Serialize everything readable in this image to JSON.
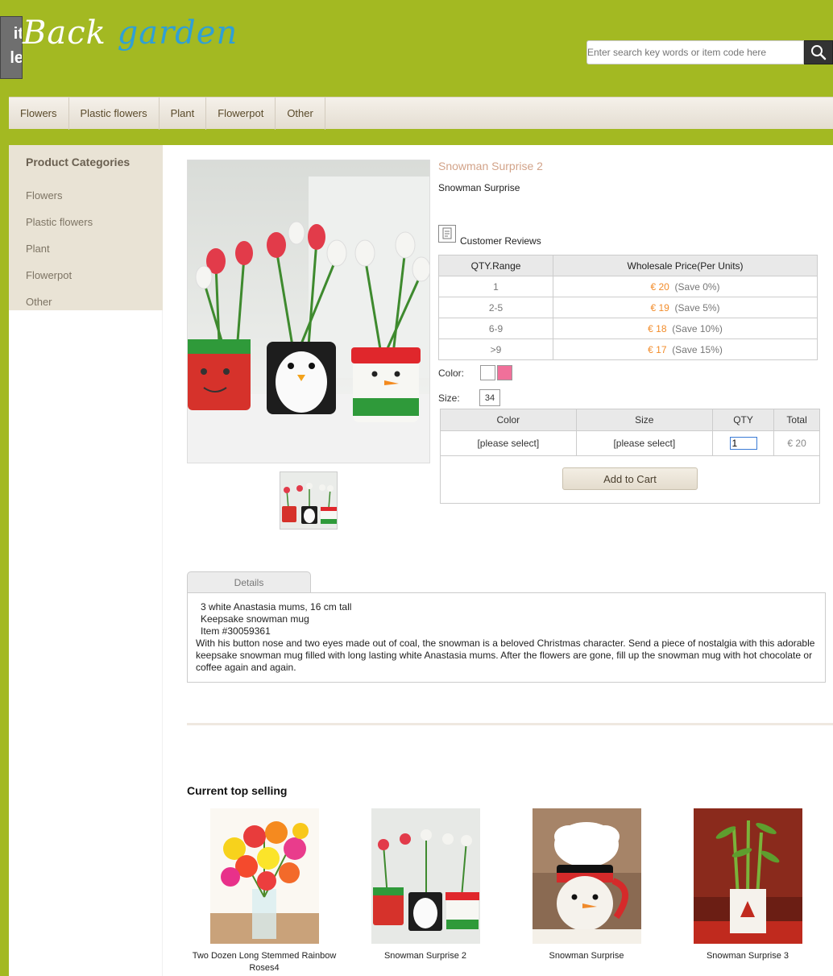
{
  "header": {
    "badge_line1": "it",
    "badge_line2": "le",
    "logo_part1": "Back",
    "logo_part2": "garden",
    "search_placeholder": "Enter search key words or item code here"
  },
  "nav": [
    "Flowers",
    "Plastic flowers",
    "Plant",
    "Flowerpot",
    "Other"
  ],
  "sidebar": {
    "title": "Product Categories",
    "items": [
      "Flowers",
      "Plastic flowers",
      "Plant",
      "Flowerpot",
      "Other"
    ]
  },
  "product": {
    "title": "Snowman Surprise 2",
    "subtitle": "Snowman Surprise",
    "reviews_label": "Customer Reviews",
    "price_headers": [
      "QTY.Range",
      "Wholesale Price(Per Units)"
    ],
    "price_rows": [
      {
        "range": "1",
        "price": "€ 20",
        "save": "(Save 0%)"
      },
      {
        "range": "2-5",
        "price": "€ 19",
        "save": "(Save 5%)"
      },
      {
        "range": "6-9",
        "price": "€ 18",
        "save": "(Save 10%)"
      },
      {
        "range": ">9",
        "price": "€ 17",
        "save": "(Save 15%)"
      }
    ],
    "color_label": "Color:",
    "swatch_colors": [
      "#ffffff",
      "#f0709a"
    ],
    "size_label": "Size:",
    "size_value": "34",
    "order_headers": [
      "Color",
      "Size",
      "QTY",
      "Total"
    ],
    "order_row": {
      "color": "[please select]",
      "size": "[please select]",
      "qty": "1",
      "total": "€ 20"
    },
    "add_to_cart": "Add to Cart"
  },
  "details": {
    "tab_label": "Details",
    "lines": [
      "3 white Anastasia mums, 16 cm tall",
      "Keepsake snowman mug",
      "Item #30059361"
    ],
    "paragraph": "With his button nose and two eyes made out of coal, the snowman is a beloved Christmas character. Send a piece of nostalgia with this adorable keepsake snowman mug filled with long lasting white Anastasia mums. After the flowers are gone, fill up the snowman mug with hot chocolate or coffee again and again."
  },
  "top_selling": {
    "title": "Current top selling",
    "items": [
      {
        "label": "Two Dozen Long Stemmed Rainbow Roses4"
      },
      {
        "label": "Snowman Surprise 2"
      },
      {
        "label": "Snowman Surprise"
      },
      {
        "label": "Snowman Surprise 3"
      }
    ]
  }
}
